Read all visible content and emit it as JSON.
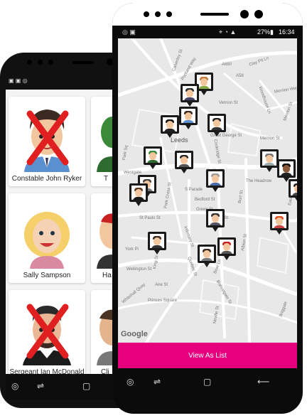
{
  "back_phone": {
    "cards": [
      {
        "name": "Constable John Ryker",
        "crossed": true
      },
      {
        "name": "Sally Sampson",
        "crossed": false
      },
      {
        "name": "Sergeant Ian McDonald",
        "crossed": true
      }
    ],
    "right_partial_labels": [
      "T",
      "Ha",
      "Cli"
    ]
  },
  "front_phone": {
    "status": {
      "time": "16:34",
      "battery": "27%"
    },
    "map": {
      "city_label": "Leeds",
      "streets": [
        "Portland Way",
        "Calverley St",
        "A660",
        "A58",
        "Clay Pit Ln",
        "Merrion Way",
        "Woodhouse Ln",
        "Vernon St",
        "Merrion St",
        "Great George St",
        "Merrion St",
        "Westgate",
        "Park Sq",
        "Cookridge St",
        "The Headrow",
        "S Parade",
        "Bedford St",
        "Park Cross St",
        "Greek St",
        "Russell St",
        "St Pauls St",
        "Infirmary St",
        "Burt St",
        "Albion St",
        "York Pl",
        "King St",
        "Wellington St",
        "Quebec St",
        "Boar Ln",
        "Whitehall Quay",
        "Aire St",
        "Princes Square",
        "Bishopgate St",
        "Neville St",
        "Briggate",
        "East Pde"
      ],
      "attribution": "Google"
    },
    "view_button_label": "View As List"
  },
  "colors": {
    "accent": "#e6007e",
    "frame": "#0b0b0b",
    "map_bg": "#e8e8e8"
  }
}
